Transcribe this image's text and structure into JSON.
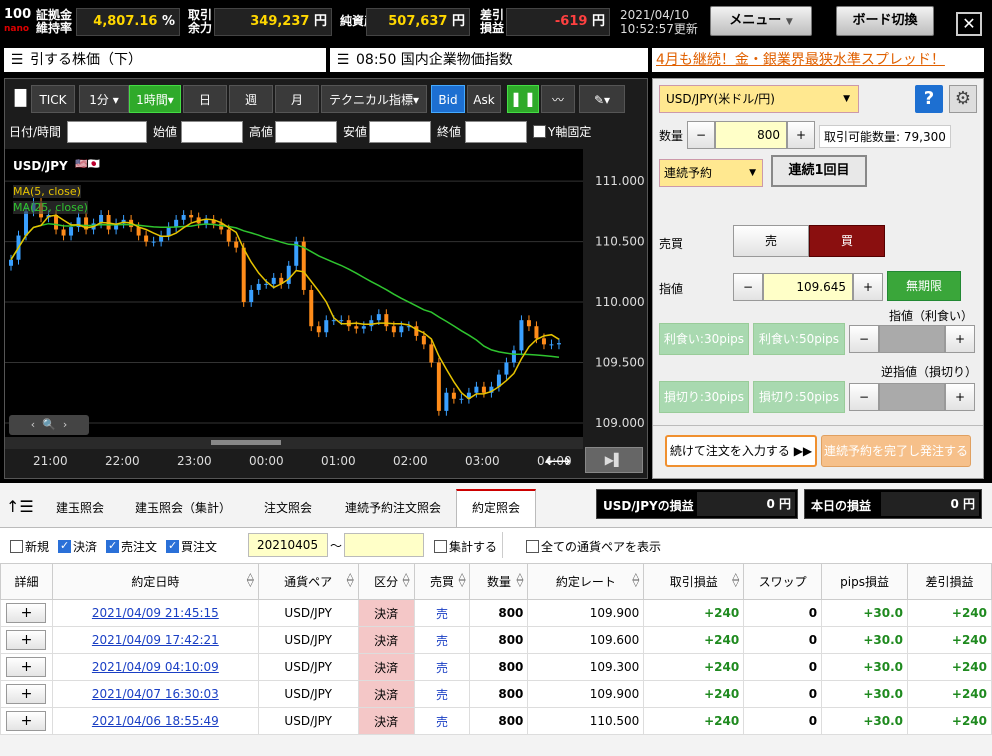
{
  "status": {
    "margin_ratio_label": "証拠金\n維持率",
    "margin_ratio_l1": "証拠金",
    "margin_ratio_l2": "維持率",
    "margin_ratio_value": "4,807.16",
    "margin_ratio_unit": "%",
    "trade_margin_l1": "取引",
    "trade_margin_l2": "余力",
    "trade_margin_value": "349,237",
    "net_assets_label": "純資産",
    "net_assets_value": "507,637",
    "pl_l1": "差引",
    "pl_l2": "損益",
    "pl_value": "-619",
    "yen": "円",
    "date": "2021/04/10",
    "time": "10:52:57更新",
    "menu_label": "メニュー",
    "board_label": "ボード切換",
    "close_label": "✕"
  },
  "news": {
    "item1": "引する株価（下）",
    "item2": "08:50 国内企業物価指数",
    "promo": "4月も継続！金・銀業界最狭水準スプレッド！"
  },
  "chart_toolbar": {
    "tick": "TICK",
    "interval1": "1分",
    "interval2": "1時間",
    "day": "日",
    "week": "週",
    "month": "月",
    "technical": "テクニカル指標",
    "bid": "Bid",
    "ask": "Ask"
  },
  "chart_fields": {
    "datetime": "日付/時間",
    "open": "始値",
    "high": "高値",
    "low": "安値",
    "close": "終値",
    "yfix": "Y軸固定"
  },
  "chart_data": {
    "type": "candlestick",
    "symbol": "USD/JPY",
    "legend": [
      "MA(5, close)",
      "MA(25, close)"
    ],
    "series_colors": {
      "ma5": "#e6c300",
      "ma25": "#2fc42f",
      "up": "#3aa0ff",
      "down": "#ff8c1a"
    },
    "y_ticks": [
      "111.000",
      "110.500",
      "110.000",
      "109.500",
      "109.000"
    ],
    "ylim": [
      108.95,
      111.15
    ],
    "x_ticks": [
      "21:00",
      "22:00",
      "23:00",
      "00:00",
      "01:00",
      "02:00",
      "03:00",
      "04:00"
    ],
    "close": [
      110.35,
      110.55,
      110.75,
      110.82,
      110.7,
      110.72,
      110.6,
      110.55,
      110.62,
      110.7,
      110.6,
      110.65,
      110.72,
      110.6,
      110.65,
      110.68,
      110.62,
      110.55,
      110.5,
      110.5,
      110.55,
      110.62,
      110.68,
      110.72,
      110.7,
      110.65,
      110.68,
      110.65,
      110.6,
      110.5,
      110.45,
      110.0,
      110.1,
      110.15,
      110.15,
      110.2,
      110.15,
      110.3,
      110.5,
      110.1,
      109.8,
      109.75,
      109.85,
      109.85,
      109.85,
      109.8,
      109.78,
      109.8,
      109.85,
      109.9,
      109.8,
      109.75,
      109.8,
      109.8,
      109.72,
      109.65,
      109.5,
      109.1,
      109.25,
      109.2,
      109.2,
      109.25,
      109.3,
      109.25,
      109.3,
      109.4,
      109.5,
      109.6,
      109.85,
      109.8,
      109.7,
      109.65,
      109.65,
      109.66
    ]
  },
  "order": {
    "pair": "USD/JPY(米ドル/円)",
    "qty_label": "数量",
    "qty_value": "800",
    "minus": "−",
    "plus": "+",
    "available": "取引可能数量: 79,300",
    "order_type": "連続予約",
    "sequence": "連続1回目",
    "side_label": "売買",
    "sell": "売",
    "buy": "買",
    "limit_label": "指値",
    "limit_value": "109.645",
    "unlimited": "無期限",
    "take_profit_label": "指値（利食い）",
    "tp30": "利食い:30pips",
    "tp50": "利食い:50pips",
    "stop_label": "逆指値（損切り）",
    "sl30": "損切り:30pips",
    "sl50": "損切り:50pips",
    "continue_btn": "続けて注文を入力する",
    "complete_btn": "連続予約を完了し発注する",
    "help": "?"
  },
  "tabs": [
    "建玉照会",
    "建玉照会（集計）",
    "注文照会",
    "連続予約注文照会",
    "約定照会"
  ],
  "pl_boxes": {
    "pair_pl_label": "USD/JPYの損益",
    "pair_pl_value": "0",
    "today_pl_label": "本日の損益",
    "today_pl_value": "0",
    "yen": "円"
  },
  "filters": {
    "new": "新規",
    "settle": "決済",
    "sell": "売注文",
    "buy": "買注文",
    "date_from": "20210405",
    "tilde": "～",
    "aggregate": "集計する",
    "all_pairs": "全ての通貨ペアを表示"
  },
  "table": {
    "headers": [
      "詳細",
      "約定日時",
      "通貨ペア",
      "区分",
      "売買",
      "数量",
      "約定レート",
      "取引損益",
      "スワップ",
      "pips損益",
      "差引損益"
    ],
    "rows": [
      {
        "dt": "2021/04/09 21:45:15",
        "pair": "USD/JPY",
        "kubun": "決済",
        "side": "売",
        "qty": "800",
        "rate": "109.900",
        "pl": "+240",
        "swap": "0",
        "pips": "+30.0",
        "net": "+240"
      },
      {
        "dt": "2021/04/09 17:42:21",
        "pair": "USD/JPY",
        "kubun": "決済",
        "side": "売",
        "qty": "800",
        "rate": "109.600",
        "pl": "+240",
        "swap": "0",
        "pips": "+30.0",
        "net": "+240"
      },
      {
        "dt": "2021/04/09 04:10:09",
        "pair": "USD/JPY",
        "kubun": "決済",
        "side": "売",
        "qty": "800",
        "rate": "109.300",
        "pl": "+240",
        "swap": "0",
        "pips": "+30.0",
        "net": "+240"
      },
      {
        "dt": "2021/04/07 16:30:03",
        "pair": "USD/JPY",
        "kubun": "決済",
        "side": "売",
        "qty": "800",
        "rate": "109.900",
        "pl": "+240",
        "swap": "0",
        "pips": "+30.0",
        "net": "+240"
      },
      {
        "dt": "2021/04/06 18:55:49",
        "pair": "USD/JPY",
        "kubun": "決済",
        "side": "売",
        "qty": "800",
        "rate": "110.500",
        "pl": "+240",
        "swap": "0",
        "pips": "+30.0",
        "net": "+240"
      }
    ],
    "plus": "+"
  }
}
